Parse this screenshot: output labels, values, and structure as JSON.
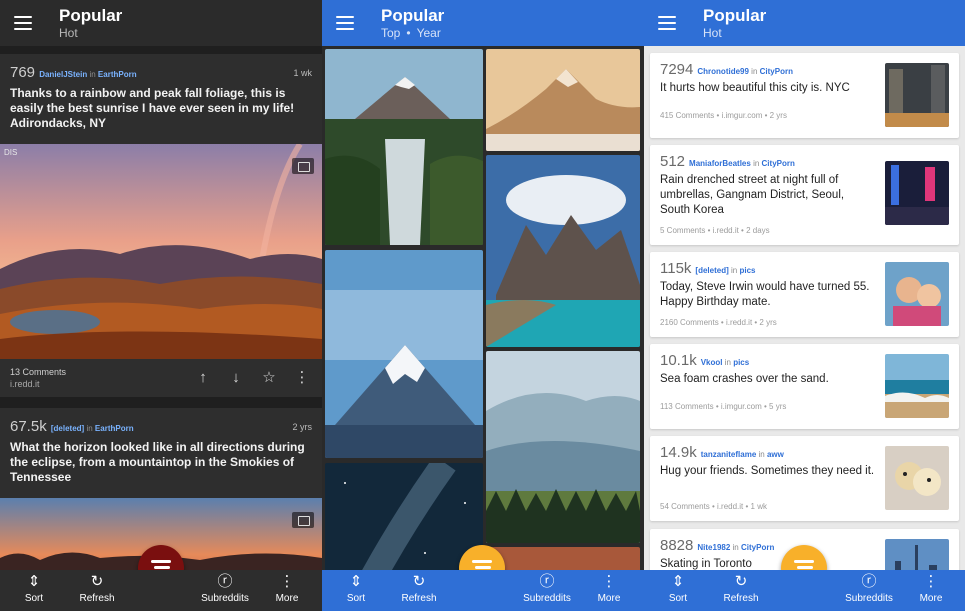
{
  "panel1": {
    "title": "Popular",
    "subtitle": "Hot",
    "posts": [
      {
        "score": "769",
        "author": "DanielJStein",
        "in": "in",
        "subreddit": "EarthPorn",
        "age": "1 wk",
        "title": "Thanks to a rainbow and peak fall foliage, this is easily the best sunrise I have ever seen in my life! Adirondacks, NY",
        "comments": "13 Comments",
        "domain": "i.redd.it"
      },
      {
        "score": "67.5k",
        "author": "[deleted]",
        "in": "in",
        "subreddit": "EarthPorn",
        "age": "2 yrs",
        "title": "What the horizon looked like in all directions during the eclipse, from a mountaintop in the Smokies of Tennessee"
      }
    ],
    "watermark": "DIS"
  },
  "panel2": {
    "title": "Popular",
    "subtitle_a": "Top",
    "subtitle_sep": "•",
    "subtitle_b": "Year"
  },
  "panel3": {
    "title": "Popular",
    "subtitle": "Hot",
    "posts": [
      {
        "score": "7294",
        "author": "Chronotide99",
        "in": "in",
        "subreddit": "CityPorn",
        "title": "It hurts how beautiful this city is. NYC",
        "meta": "415 Comments • i.imgur.com • 2 yrs"
      },
      {
        "score": "512",
        "author": "ManiaforBeatles",
        "in": "in",
        "subreddit": "CityPorn",
        "title": "Rain drenched street at night full of umbrellas, Gangnam District, Seoul, South Korea",
        "meta": "5 Comments • i.redd.it • 2 days"
      },
      {
        "score": "115k",
        "author": "[deleted]",
        "in": "in",
        "subreddit": "pics",
        "title": "Today, Steve Irwin would have turned 55. Happy Birthday mate.",
        "meta": "2160 Comments • i.redd.it • 2 yrs"
      },
      {
        "score": "10.1k",
        "author": "Vkool",
        "in": "in",
        "subreddit": "pics",
        "title": "Sea foam crashes over the sand.",
        "meta": "113 Comments • i.imgur.com • 5 yrs"
      },
      {
        "score": "14.9k",
        "author": "tanzaniteflame",
        "in": "in",
        "subreddit": "aww",
        "title": "Hug your friends. Sometimes they need it.",
        "meta": "54 Comments • i.redd.it • 1 wk"
      },
      {
        "score": "8828",
        "author": "Nite1982",
        "in": "in",
        "subreddit": "CityPorn",
        "title": "Skating in Toronto",
        "meta": ""
      }
    ]
  },
  "bottom_nav": {
    "sort": "Sort",
    "refresh": "Refresh",
    "subreddits": "Subreddits",
    "more": "More"
  },
  "colors": {
    "accent_blue": "#2f6fd6",
    "fab_red": "#7a0f0f",
    "fab_orange": "#f8b02a",
    "dark_bg": "#1f1f1f",
    "link_blue": "#7ab3ff"
  }
}
